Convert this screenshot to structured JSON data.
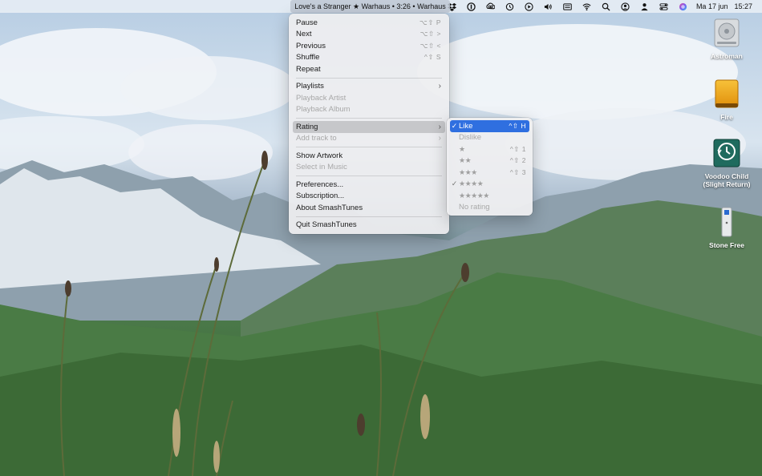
{
  "now_playing": "Love's a Stranger ★ Warhaus • 3:26 • Warhaus",
  "clock": {
    "date": "Ma 17 jun",
    "time": "15:27"
  },
  "status_icons": [
    "dropbox-icon",
    "onepassword-icon",
    "creative-cloud-icon",
    "time-machine-icon",
    "play-icon",
    "volume-icon",
    "keyboard-input-icon",
    "wifi-icon",
    "spotlight-icon",
    "user-circle-icon",
    "user-icon",
    "control-center-icon",
    "siri-icon"
  ],
  "menu": {
    "pause": {
      "label": "Pause",
      "shortcut": "⌥⇧ P"
    },
    "next": {
      "label": "Next",
      "shortcut": "⌥⇧ >"
    },
    "previous": {
      "label": "Previous",
      "shortcut": "⌥⇧ <"
    },
    "shuffle": {
      "label": "Shuffle",
      "shortcut": "^⇧ S"
    },
    "repeat": {
      "label": "Repeat"
    },
    "playlists": {
      "label": "Playlists"
    },
    "playback_artist": {
      "label": "Playback Artist"
    },
    "playback_album": {
      "label": "Playback Album"
    },
    "rating": {
      "label": "Rating"
    },
    "add_track_to": {
      "label": "Add track to"
    },
    "show_artwork": {
      "label": "Show Artwork"
    },
    "select_in_music": {
      "label": "Select in Music"
    },
    "preferences": {
      "label": "Preferences..."
    },
    "subscription": {
      "label": "Subscription..."
    },
    "about": {
      "label": "About SmashTunes"
    },
    "quit": {
      "label": "Quit SmashTunes"
    }
  },
  "rating_submenu": {
    "like": {
      "label": "Like",
      "shortcut": "^⇧ H",
      "checked": true
    },
    "dislike": {
      "label": "Dislike"
    },
    "one_star": {
      "label": "★",
      "shortcut": "^⇧ 1"
    },
    "two_star": {
      "label": "★★",
      "shortcut": "^⇧ 2"
    },
    "three_star": {
      "label": "★★★",
      "shortcut": "^⇧ 3"
    },
    "four_star": {
      "label": "★★★★",
      "checked": true
    },
    "five_star": {
      "label": "★★★★★"
    },
    "no_rating": {
      "label": "No rating"
    },
    "check_glyph": "✓"
  },
  "desktop_icons": [
    {
      "label": "Astroman"
    },
    {
      "label": "Fire"
    },
    {
      "label": "Voodoo Child (Slight Return)"
    },
    {
      "label": "Stone Free"
    }
  ]
}
